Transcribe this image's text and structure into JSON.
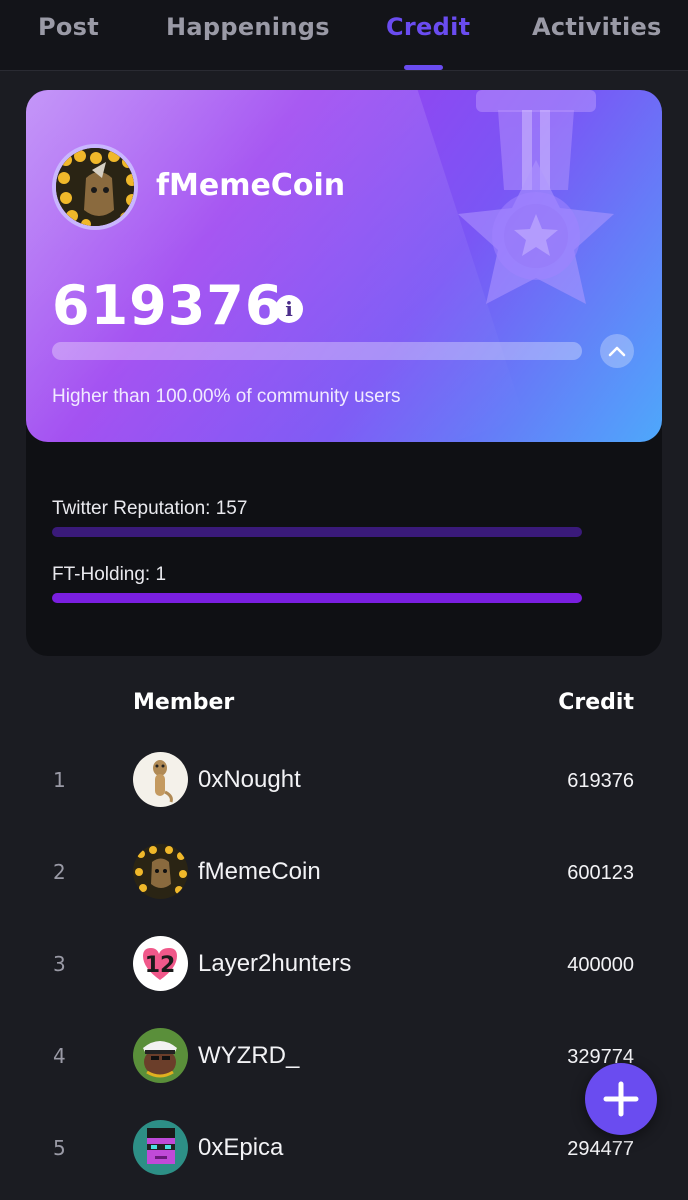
{
  "tabs": [
    {
      "label": "Post"
    },
    {
      "label": "Happenings"
    },
    {
      "label": "Credit"
    },
    {
      "label": "Activities"
    }
  ],
  "active_tab": "Credit",
  "card": {
    "name": "fMemeCoin",
    "score": "619376",
    "info_icon": "i",
    "percentile_text": "Higher than 100.00% of community users"
  },
  "metrics": [
    {
      "label": "Twitter Reputation: 157",
      "color": "#3a1a7a"
    },
    {
      "label": "FT-Holding: 1",
      "color": "#7a1fe0"
    }
  ],
  "table": {
    "header_member": "Member",
    "header_credit": "Credit",
    "rows": [
      {
        "rank": "1",
        "name": "0xNought",
        "credit": "619376",
        "avatar": "meerkat-avatar"
      },
      {
        "rank": "2",
        "name": "fMemeCoin",
        "credit": "600123",
        "avatar": "coin-cat-avatar"
      },
      {
        "rank": "3",
        "name": "Layer2hunters",
        "credit": "400000",
        "avatar": "l2-logo-avatar"
      },
      {
        "rank": "4",
        "name": "WYZRD_",
        "credit": "329774",
        "avatar": "captain-avatar"
      },
      {
        "rank": "5",
        "name": "0xEpica",
        "credit": "294477",
        "avatar": "pixel-face-avatar"
      }
    ]
  },
  "colors": {
    "accent": "#6a4cf0",
    "background": "#1b1c22"
  },
  "fab_icon": "plus-icon"
}
